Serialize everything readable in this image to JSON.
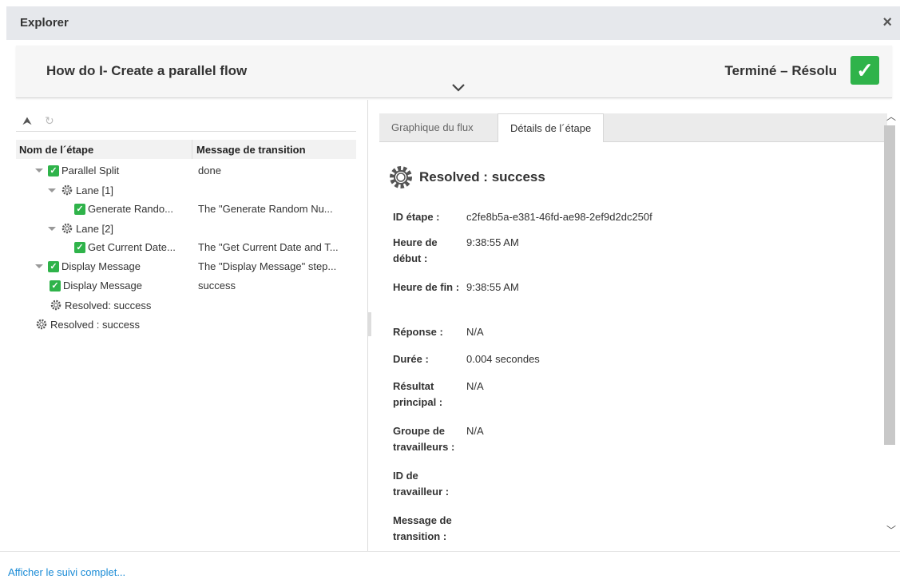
{
  "window": {
    "title": "Explorer",
    "close_glyph": "×"
  },
  "flow": {
    "title": "How do I- Create a parallel flow",
    "status": "Terminé – Résolu",
    "status_icon": "check-icon",
    "status_color": "#2fb34a"
  },
  "left_toolbar": {
    "collapse_icon": "collapse-all-icon",
    "replay_icon": "replay-icon"
  },
  "tree": {
    "headers": {
      "name": "Nom de l´étape",
      "message": "Message de transition"
    },
    "rows": [
      {
        "name": "Parallel Split",
        "message": "done",
        "icon": "check-icon",
        "expanded": true
      },
      {
        "name": "Lane [1]",
        "message": "",
        "icon": "gear-icon",
        "expanded": true
      },
      {
        "name": "Generate Rando...",
        "message": "The \"Generate Random Nu...",
        "icon": "check-icon"
      },
      {
        "name": "Lane [2]",
        "message": "",
        "icon": "gear-icon",
        "expanded": true
      },
      {
        "name": "Get Current Date...",
        "message": "The \"Get Current Date and T...",
        "icon": "check-icon"
      },
      {
        "name": "Display Message",
        "message": "The \"Display Message\" step...",
        "icon": "check-icon",
        "expanded": true
      },
      {
        "name": "Display Message",
        "message": "success",
        "icon": "check-icon"
      },
      {
        "name": "Resolved: success",
        "message": "",
        "icon": "gear-icon"
      },
      {
        "name": "Resolved : success",
        "message": "",
        "icon": "gear-icon"
      }
    ]
  },
  "tabs": {
    "graph": "Graphique du flux",
    "details": "Détails de l´étape"
  },
  "details": {
    "heading": "Resolved : success",
    "fields": [
      {
        "key": "ID étape :",
        "value": "c2fe8b5a-e381-46fd-ae98-2ef9d2dc250f"
      },
      {
        "key": "Heure de début :",
        "value": "9:38:55 AM"
      },
      {
        "key": "Heure de fin :",
        "value": "9:38:55 AM"
      },
      {
        "key": "Réponse :",
        "value": "N/A"
      },
      {
        "key": "Durée :",
        "value": "0.004 secondes"
      },
      {
        "key": "Résultat principal :",
        "value": "N/A"
      },
      {
        "key": "Groupe de travailleurs :",
        "value": "N/A"
      },
      {
        "key": "ID de travailleur :",
        "value": ""
      },
      {
        "key": "Message de transition :",
        "value": ""
      }
    ]
  },
  "footer": {
    "link": "Afficher le suivi complet..."
  }
}
